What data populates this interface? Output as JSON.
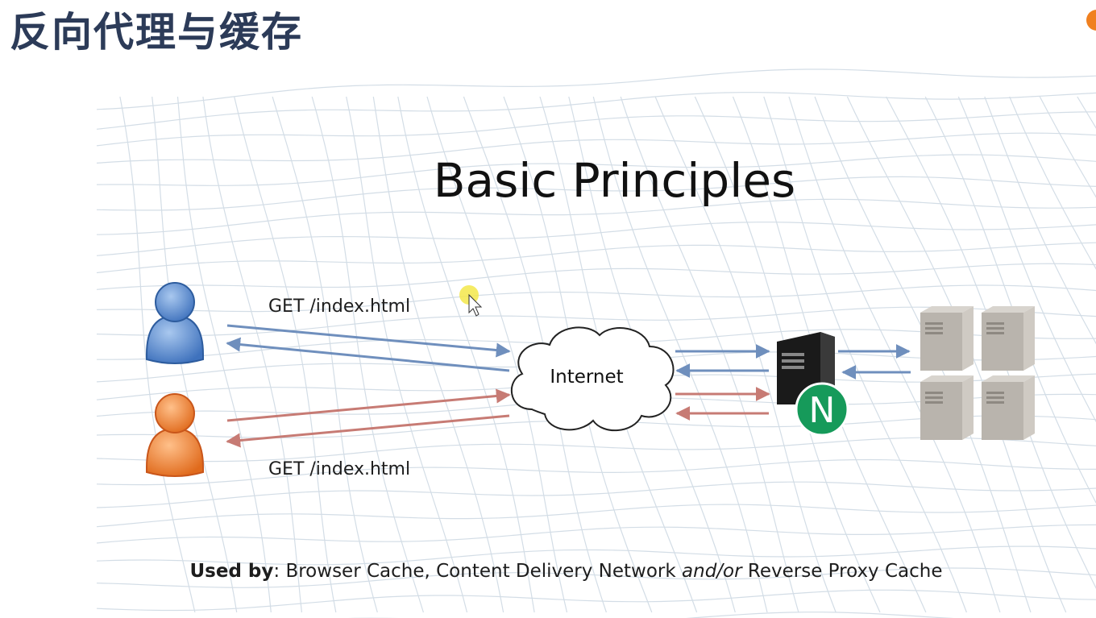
{
  "slide": {
    "title": "反向代理与缓存",
    "accent_color": "#f0801f",
    "title_color": "#2c3b58"
  },
  "diagram": {
    "heading": "Basic Principles",
    "cloud_label": "Internet",
    "proxy_badge_letter": "N",
    "request_label_top": "GET /index.html",
    "request_label_bottom": "GET /index.html",
    "colors": {
      "blue_flow": "#6f8fbd",
      "red_flow": "#c77b74",
      "user_blue": "#5b8fd6",
      "user_orange": "#f28a3a",
      "badge_green": "#169a5a",
      "origin_server": "#b9b4ad"
    },
    "icons": {
      "users": [
        "user-blue-icon",
        "user-orange-icon"
      ],
      "cloud": "cloud-icon",
      "proxy": "proxy-server-icon",
      "origin": "origin-server-icon"
    }
  },
  "footer": {
    "used_by_label": "Used by",
    "items_part1": ": Browser Cache, Content Delivery Network ",
    "conjunction": "and/or",
    "items_part2": " Reverse Proxy Cache"
  }
}
